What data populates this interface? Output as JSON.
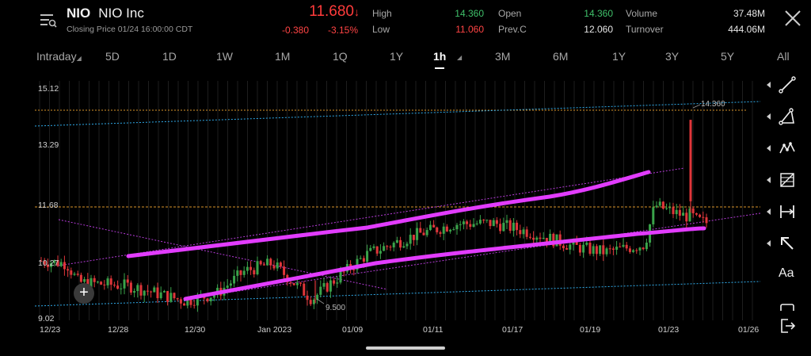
{
  "header": {
    "symbol": "NIO",
    "name": "NIO Inc",
    "closing_label": "Closing Price  01/24 16:00:00 CDT",
    "price": "11.680",
    "change": "-0.380",
    "change_pct": "-3.15%",
    "high_label": "High",
    "high_value": "14.360",
    "low_label": "Low",
    "low_value": "11.060",
    "open_label": "Open",
    "open_value": "14.360",
    "prevc_label": "Prev.C",
    "prevc_value": "12.060",
    "volume_label": "Volume",
    "volume_value": "37.48M",
    "turnover_label": "Turnover",
    "turnover_value": "444.06M"
  },
  "tabs": [
    "Intraday",
    "5D",
    "1D",
    "1W",
    "1M",
    "1Q",
    "1Y",
    "1h",
    "3M",
    "6M",
    "1Y",
    "3Y",
    "5Y",
    "All"
  ],
  "active_tab": "1h",
  "chart_data": {
    "type": "candlestick",
    "y_ticks": [
      "15.12",
      "13.29",
      "11.68",
      "10.27",
      "9.02"
    ],
    "x_ticks": [
      "12/23",
      "12/28",
      "12/30",
      "Jan 2023",
      "01/09",
      "01/11",
      "01/17",
      "01/19",
      "01/23",
      "01/26"
    ],
    "ylim": [
      9.02,
      15.12
    ],
    "annotations": {
      "high": "14.360",
      "low": "9.500"
    },
    "reference_line": "11.68"
  },
  "toolbar": [
    "line-tool-icon",
    "triangle-tool-icon",
    "pattern-tool-icon",
    "fib-tool-icon",
    "range-tool-icon",
    "arrow-tool-icon",
    "text-tool-label",
    "rectangle-tool-icon",
    "exit-icon"
  ],
  "toolbar_text": "Aa",
  "add_button": "+",
  "colors": {
    "up": "#3aa34a",
    "down": "#e0363a",
    "trend": "#e23cff",
    "accent_orange": "#d9932a",
    "accent_blue": "#2fa8e6"
  }
}
